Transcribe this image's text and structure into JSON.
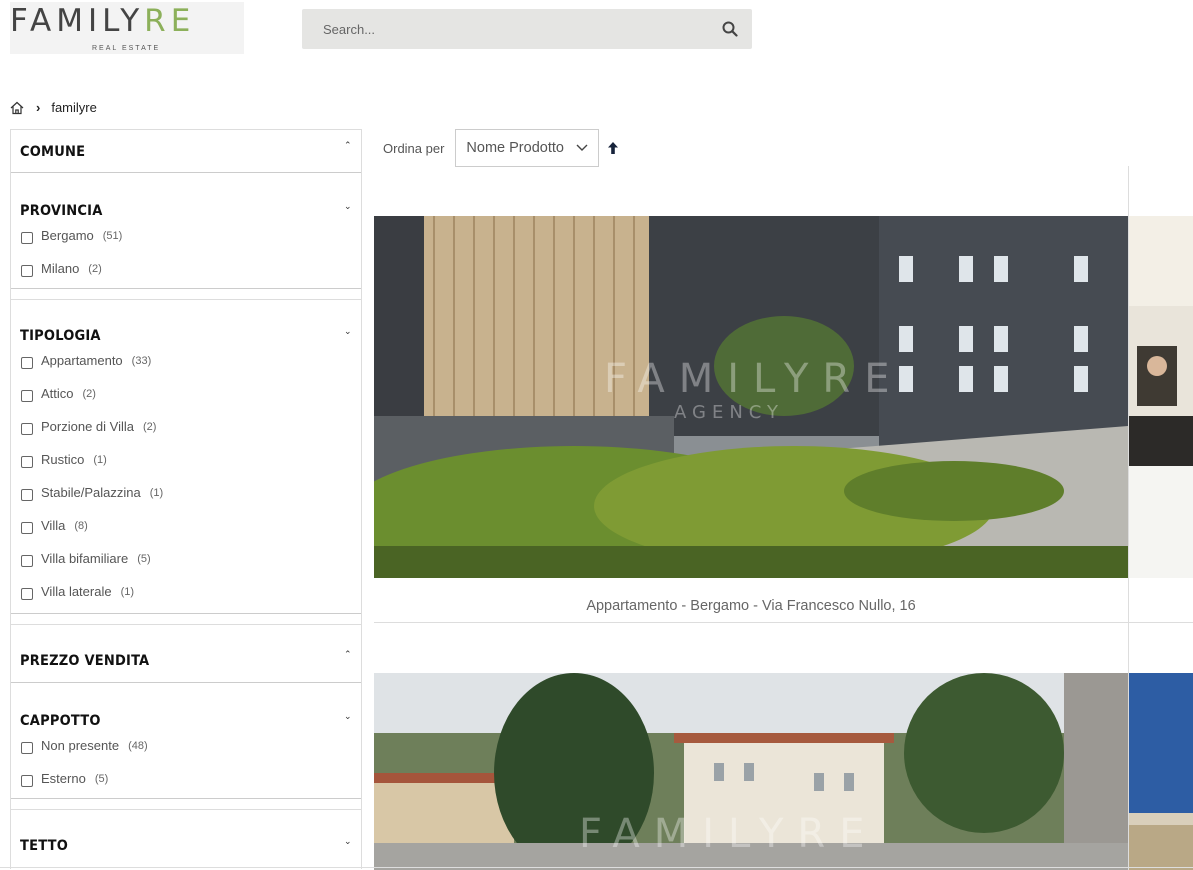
{
  "header": {
    "logo_main": "FAMILY",
    "logo_accent": "RE",
    "logo_sub": "REAL ESTATE",
    "search_placeholder": "Search...",
    "brand_green": "#8cb05a"
  },
  "breadcrumb": {
    "home_icon": "home-icon",
    "current": "familyre"
  },
  "filters": {
    "comune": {
      "title": "COMUNE"
    },
    "provincia": {
      "title": "PROVINCIA",
      "options": [
        {
          "label": "Bergamo",
          "count": "(51)"
        },
        {
          "label": "Milano",
          "count": "(2)"
        }
      ]
    },
    "tipologia": {
      "title": "TIPOLOGIA",
      "options": [
        {
          "label": "Appartamento",
          "count": "(33)"
        },
        {
          "label": "Attico",
          "count": "(2)"
        },
        {
          "label": "Porzione di Villa",
          "count": "(2)"
        },
        {
          "label": "Rustico",
          "count": "(1)"
        },
        {
          "label": "Stabile/Palazzina",
          "count": "(1)"
        },
        {
          "label": "Villa",
          "count": "(8)"
        },
        {
          "label": "Villa bifamiliare",
          "count": "(5)"
        },
        {
          "label": "Villa laterale",
          "count": "(1)"
        }
      ]
    },
    "prezzo": {
      "title": "PREZZO VENDITA"
    },
    "cappotto": {
      "title": "CAPPOTTO",
      "options": [
        {
          "label": "Non presente",
          "count": "(48)"
        },
        {
          "label": "Esterno",
          "count": "(5)"
        }
      ]
    },
    "tetto": {
      "title": "TETTO"
    }
  },
  "sort": {
    "label": "Ordina per",
    "selected": "Nome Prodotto",
    "direction_icon": "sort-ascending-arrow-icon"
  },
  "products": [
    {
      "caption": "Appartamento - Bergamo - Via Francesco Nullo, 16",
      "watermark_main": "FAMILYRE",
      "watermark_sub": "AGENCY"
    },
    {
      "watermark_main": "FAMILYRE"
    }
  ]
}
